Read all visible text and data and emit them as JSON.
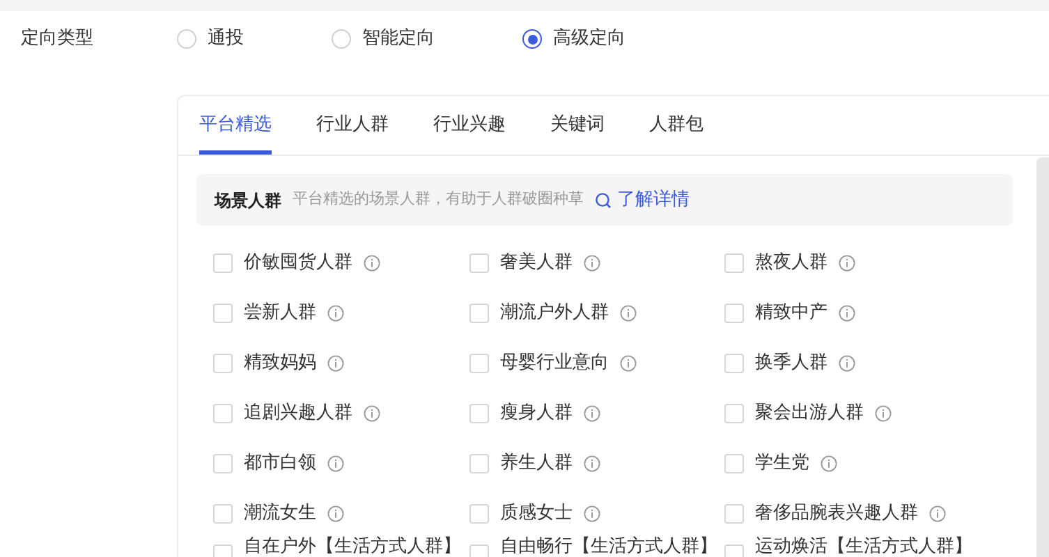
{
  "targeting": {
    "label": "定向类型",
    "options": [
      {
        "label": "通投",
        "selected": false
      },
      {
        "label": "智能定向",
        "selected": false
      },
      {
        "label": "高级定向",
        "selected": true
      }
    ]
  },
  "tabs": [
    {
      "label": "平台精选",
      "selected": true
    },
    {
      "label": "行业人群",
      "selected": false
    },
    {
      "label": "行业兴趣",
      "selected": false
    },
    {
      "label": "关键词",
      "selected": false
    },
    {
      "label": "人群包",
      "selected": false
    }
  ],
  "section": {
    "title": "场景人群",
    "description": "平台精选的场景人群，有助于人群破圈种草",
    "link": "了解详情"
  },
  "audiences": [
    {
      "label": "价敏囤货人群",
      "checked": false
    },
    {
      "label": "奢美人群",
      "checked": false
    },
    {
      "label": "熬夜人群",
      "checked": false
    },
    {
      "label": "尝新人群",
      "checked": false
    },
    {
      "label": "潮流户外人群",
      "checked": false
    },
    {
      "label": "精致中产",
      "checked": false
    },
    {
      "label": "精致妈妈",
      "checked": false
    },
    {
      "label": "母婴行业意向",
      "checked": false
    },
    {
      "label": "换季人群",
      "checked": false
    },
    {
      "label": "追剧兴趣人群",
      "checked": false
    },
    {
      "label": "瘦身人群",
      "checked": false
    },
    {
      "label": "聚会出游人群",
      "checked": false
    },
    {
      "label": "都市白领",
      "checked": false
    },
    {
      "label": "养生人群",
      "checked": false
    },
    {
      "label": "学生党",
      "checked": false
    },
    {
      "label": "潮流女生",
      "checked": false
    },
    {
      "label": "质感女士",
      "checked": false
    },
    {
      "label": "奢侈品腕表兴趣人群",
      "checked": false
    },
    {
      "label": "自在户外【生活方式人群】",
      "checked": false
    },
    {
      "label": "自由畅行【生活方式人群】",
      "checked": false
    },
    {
      "label": "运动焕活【生活方式人群】",
      "checked": false
    }
  ]
}
